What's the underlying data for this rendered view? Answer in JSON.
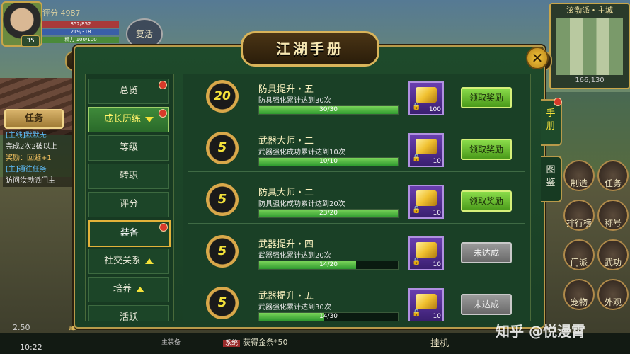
{
  "hud": {
    "score_label": "评分 4987",
    "level": "35",
    "hp": "852/852",
    "mp": "219/318",
    "sp": "精力 100/100",
    "revive": "复活",
    "task_button": "任务",
    "left_tasks": [
      {
        "text": "[主线]默默无",
        "kind": "q"
      },
      {
        "text": "完成2次2破以上",
        "kind": "d"
      },
      {
        "text": "奖励：回避+1",
        "kind": "r"
      },
      {
        "text": "[主]通往任务",
        "kind": "q"
      },
      {
        "text": "访问汝渤派门主",
        "kind": "d"
      }
    ],
    "speed": "2.50",
    "time": "10:22",
    "equip_label": "主装备",
    "loot_tag": "系统",
    "loot_text": "获得金条*50",
    "afk": "挂机"
  },
  "minimap": {
    "title": "泫渤派・主城",
    "coords": "166,130"
  },
  "right_icons": [
    {
      "label": "任务"
    },
    {
      "label": "称号"
    },
    {
      "label": "武功"
    },
    {
      "label": "外观"
    },
    {
      "label": "宠物"
    },
    {
      "label": "门派"
    },
    {
      "label": "排行榜"
    },
    {
      "label": "制造"
    }
  ],
  "panel": {
    "title": "江湖手册",
    "close_glyph": "✕",
    "tabs": [
      {
        "label": "手\n册",
        "active": true
      },
      {
        "label": "图\n鉴",
        "active": false
      }
    ],
    "categories": [
      {
        "label": "总览",
        "dot": true
      },
      {
        "label": "成长历练",
        "dot": true,
        "selected": "green",
        "arrow": "down"
      },
      {
        "label": "等级"
      },
      {
        "label": "转职"
      },
      {
        "label": "评分"
      },
      {
        "label": "装备",
        "dot": true,
        "selected": "gold"
      },
      {
        "label": "社交关系",
        "arrow": "up"
      },
      {
        "label": "培养",
        "arrow": "up"
      },
      {
        "label": "活跃"
      }
    ],
    "achievements": [
      {
        "medal": "20",
        "title": "防具提升・五",
        "desc": "防具强化累计达到30次",
        "progress": "30/30",
        "fraction": 1.0,
        "reward_qty": "100",
        "button": "领取奖励",
        "claimable": true
      },
      {
        "medal": "5",
        "title": "武器大师・二",
        "desc": "武器强化成功累计达到10次",
        "progress": "10/10",
        "fraction": 1.0,
        "reward_qty": "10",
        "button": "领取奖励",
        "claimable": true
      },
      {
        "medal": "5",
        "title": "防具大师・二",
        "desc": "防具强化成功累计达到20次",
        "progress": "23/20",
        "fraction": 1.0,
        "reward_qty": "10",
        "button": "领取奖励",
        "claimable": true
      },
      {
        "medal": "5",
        "title": "武器提升・四",
        "desc": "武器强化累计达到20次",
        "progress": "14/20",
        "fraction": 0.7,
        "reward_qty": "10",
        "button": "未达成",
        "claimable": false
      },
      {
        "medal": "5",
        "title": "武器提升・五",
        "desc": "武器强化累计达到30次",
        "progress": "14/30",
        "fraction": 0.47,
        "reward_qty": "10",
        "button": "未达成",
        "claimable": false
      }
    ]
  },
  "watermark": "知乎 @悦漫霄"
}
